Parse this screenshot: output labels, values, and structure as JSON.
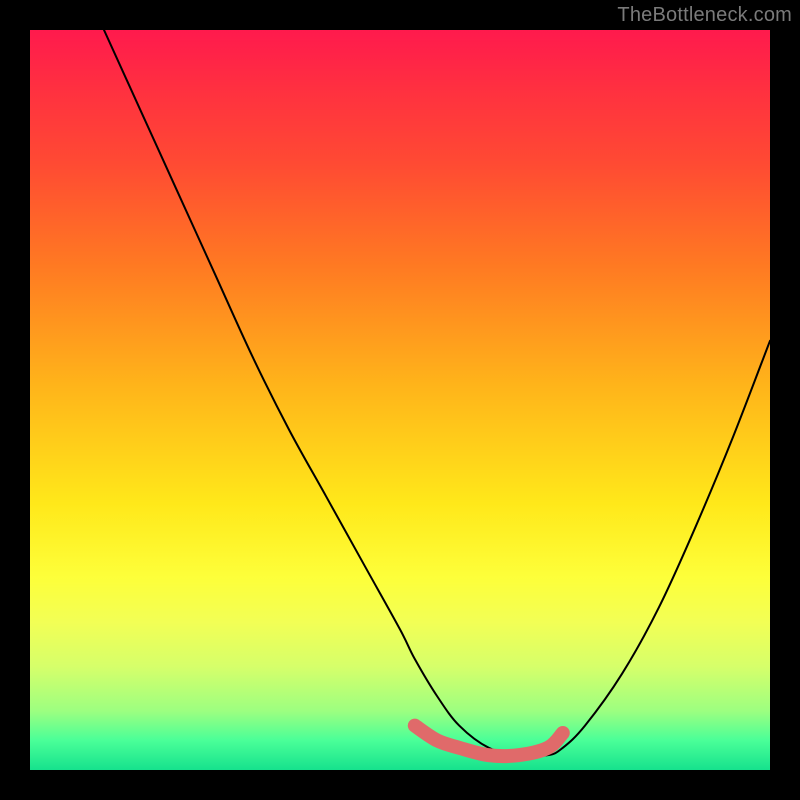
{
  "watermark": "TheBottleneck.com",
  "chart_data": {
    "type": "line",
    "title": "",
    "xlabel": "",
    "ylabel": "",
    "xlim": [
      0,
      100
    ],
    "ylim": [
      0,
      100
    ],
    "grid": false,
    "legend": false,
    "series": [
      {
        "name": "black-curve",
        "stroke": "#000000",
        "stroke_width": 2,
        "x": [
          10,
          15,
          20,
          25,
          30,
          35,
          40,
          45,
          50,
          52,
          55,
          58,
          62,
          66,
          70,
          72,
          75,
          80,
          85,
          90,
          95,
          100
        ],
        "values": [
          100,
          89,
          78,
          67,
          56,
          46,
          37,
          28,
          19,
          15,
          10,
          6,
          3,
          2,
          2,
          3,
          6,
          13,
          22,
          33,
          45,
          58
        ]
      },
      {
        "name": "pink-highlight",
        "stroke": "#e06a6a",
        "stroke_width": 10,
        "x": [
          52,
          55,
          58,
          62,
          66,
          70,
          72
        ],
        "values": [
          6,
          4,
          3,
          2,
          2,
          3,
          5
        ]
      }
    ],
    "gradient_stops": [
      {
        "pos": 0,
        "color": "#ff1a4d"
      },
      {
        "pos": 8,
        "color": "#ff3040"
      },
      {
        "pos": 18,
        "color": "#ff4a33"
      },
      {
        "pos": 32,
        "color": "#ff7a22"
      },
      {
        "pos": 48,
        "color": "#ffb41a"
      },
      {
        "pos": 64,
        "color": "#ffe81a"
      },
      {
        "pos": 74,
        "color": "#fdff3a"
      },
      {
        "pos": 80,
        "color": "#f2ff55"
      },
      {
        "pos": 86,
        "color": "#d6ff6a"
      },
      {
        "pos": 92,
        "color": "#9dff80"
      },
      {
        "pos": 96,
        "color": "#4aff98"
      },
      {
        "pos": 100,
        "color": "#16e28d"
      }
    ]
  }
}
